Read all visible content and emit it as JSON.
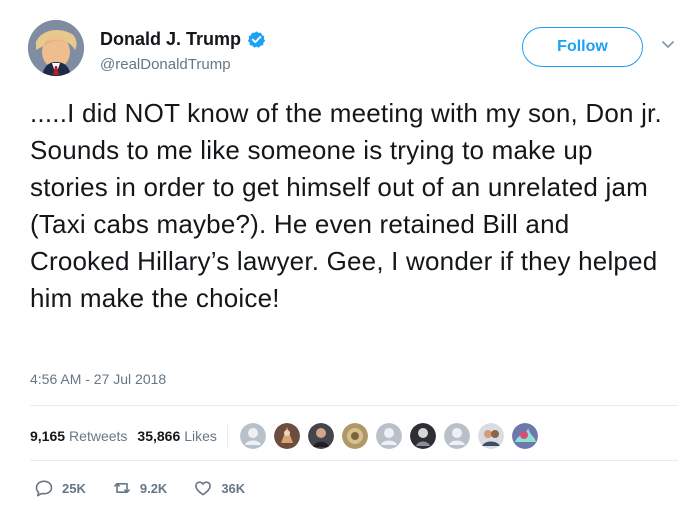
{
  "author": {
    "display_name": "Donald J. Trump",
    "handle": "@realDonaldTrump",
    "verified": true
  },
  "follow_button": {
    "label": "Follow"
  },
  "tweet": {
    "text": ".....I did NOT know of the meeting with my son, Don jr. Sounds to me like someone is trying to make up stories in order to get himself out of an unrelated jam (Taxi cabs maybe?). He even retained Bill and Crooked Hillary’s lawyer. Gee, I wonder if they helped him make the choice!",
    "timestamp": "4:56 AM - 27 Jul 2018"
  },
  "stats": {
    "retweets": {
      "count": "9,165",
      "label": "Retweets"
    },
    "likes": {
      "count": "35,866",
      "label": "Likes"
    }
  },
  "actions": {
    "reply_count": "25K",
    "retweet_count": "9.2K",
    "like_count": "36K"
  },
  "colors": {
    "accent": "#1da1f2",
    "text": "#14171a",
    "secondary": "#657786",
    "border": "#e6ecf0"
  },
  "icons": {
    "verified": "verified-badge-icon",
    "caret": "chevron-down-icon",
    "reply": "reply-icon",
    "retweet": "retweet-icon",
    "like": "heart-icon"
  }
}
